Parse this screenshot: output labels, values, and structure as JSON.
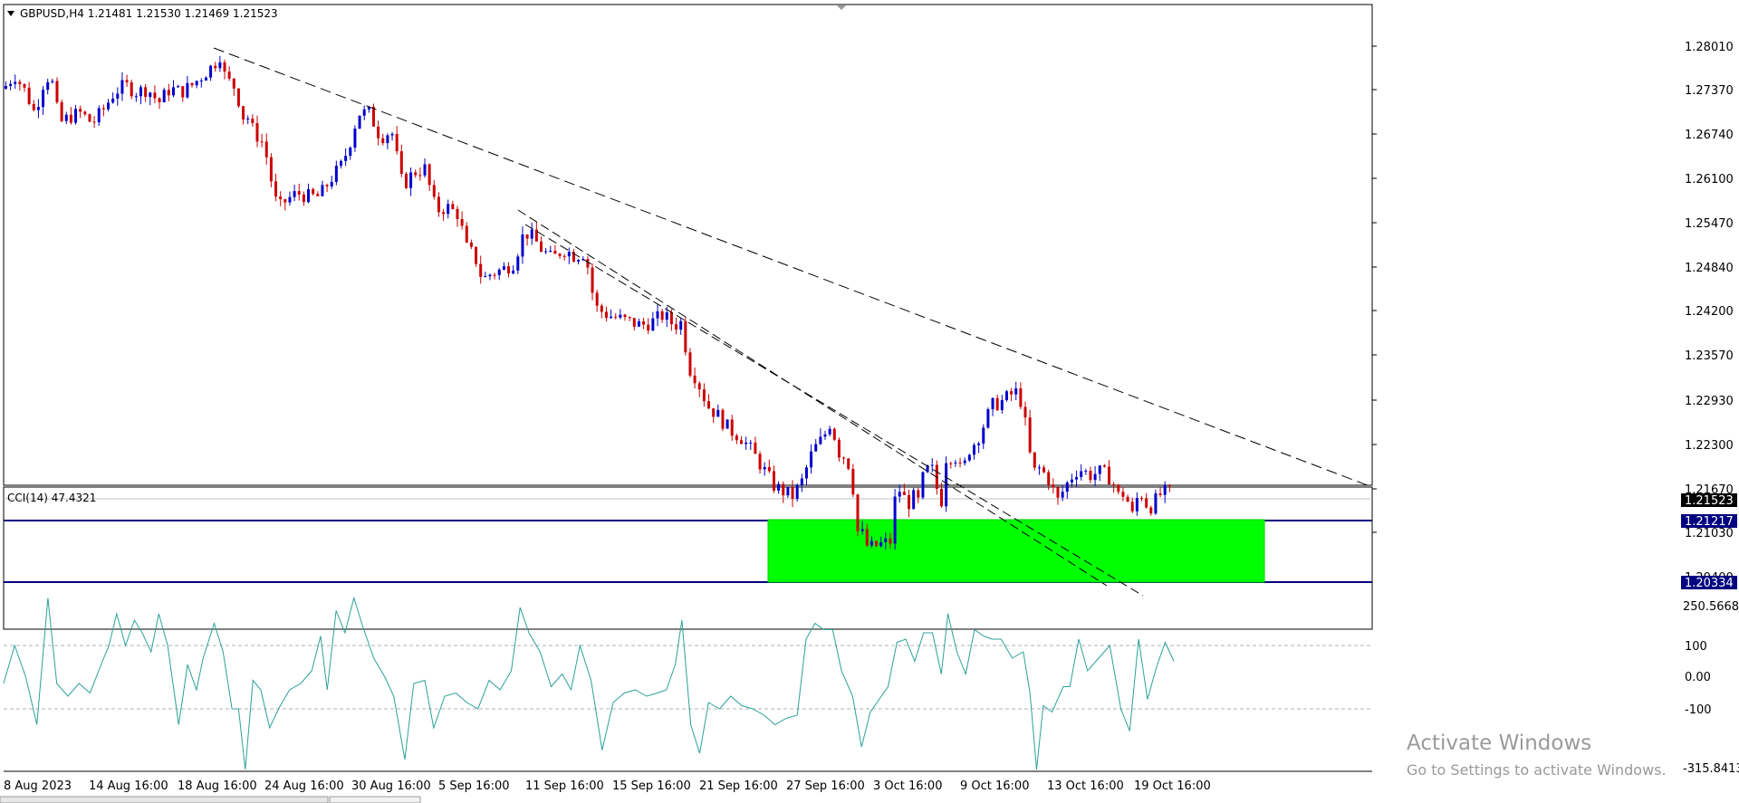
{
  "header": {
    "symbol_line": "GBPUSD,H4  1.21481 1.21530 1.21469 1.21523"
  },
  "price_axis": {
    "ticks": [
      "1.28010",
      "1.27370",
      "1.26740",
      "1.26100",
      "1.25470",
      "1.24840",
      "1.24200",
      "1.23570",
      "1.22930",
      "1.22300",
      "1.21670",
      "1.21030",
      "1.20400"
    ],
    "current_price": "1.21523",
    "support_top": "1.21217",
    "support_bottom": "1.20334"
  },
  "indicator": {
    "label": "CCI(14) 47.4321",
    "ticks": [
      "250.5668",
      "100",
      "0.00",
      "-100",
      "-315.8413"
    ],
    "color": "#2aa198"
  },
  "time_axis": {
    "labels": [
      "8 Aug 2023",
      "14 Aug 16:00",
      "18 Aug 16:00",
      "24 Aug 16:00",
      "30 Aug 16:00",
      "5 Sep 16:00",
      "11 Sep 16:00",
      "15 Sep 16:00",
      "21 Sep 16:00",
      "27 Sep 16:00",
      "3 Oct 16:00",
      "9 Oct 16:00",
      "13 Oct 16:00",
      "19 Oct 16:00"
    ]
  },
  "watermark": {
    "title": "Activate Windows",
    "subtitle": "Go to Settings to activate Windows."
  },
  "colors": {
    "bull": "#0000cc",
    "bear": "#cc0000",
    "support_zone": "#00ff00",
    "level_line": "#000080"
  },
  "chart_data": [
    {
      "type": "candlestick",
      "title": "GBPUSD,H4",
      "x_labels": [
        "8 Aug 2023",
        "14 Aug 16:00",
        "18 Aug 16:00",
        "24 Aug 16:00",
        "30 Aug 16:00",
        "5 Sep 16:00",
        "11 Sep 16:00",
        "15 Sep 16:00",
        "21 Sep 16:00",
        "27 Sep 16:00",
        "3 Oct 16:00",
        "9 Oct 16:00",
        "13 Oct 16:00",
        "19 Oct 16:00"
      ],
      "ylim": [
        1.2033,
        1.284
      ],
      "close_path": [
        [
          0,
          1.274
        ],
        [
          10,
          1.276
        ],
        [
          20,
          1.2735
        ],
        [
          28,
          1.2705
        ],
        [
          38,
          1.276
        ],
        [
          45,
          1.2745
        ],
        [
          50,
          1.269
        ],
        [
          60,
          1.27
        ],
        [
          70,
          1.2705
        ],
        [
          80,
          1.269
        ],
        [
          90,
          1.271
        ],
        [
          100,
          1.2735
        ],
        [
          110,
          1.2745
        ],
        [
          120,
          1.2735
        ],
        [
          130,
          1.274
        ],
        [
          140,
          1.272
        ],
        [
          150,
          1.274
        ],
        [
          160,
          1.2735
        ],
        [
          170,
          1.2745
        ],
        [
          180,
          1.276
        ],
        [
          190,
          1.2775
        ],
        [
          195,
          1.279
        ],
        [
          200,
          1.2755
        ],
        [
          210,
          1.274
        ],
        [
          215,
          1.27
        ],
        [
          220,
          1.27
        ],
        [
          225,
          1.268
        ],
        [
          235,
          1.266
        ],
        [
          240,
          1.262
        ],
        [
          245,
          1.258
        ],
        [
          250,
          1.257
        ],
        [
          255,
          1.258
        ],
        [
          265,
          1.259
        ],
        [
          275,
          1.2585
        ],
        [
          285,
          1.2585
        ],
        [
          295,
          1.261
        ],
        [
          305,
          1.263
        ],
        [
          312,
          1.266
        ],
        [
          320,
          1.2705
        ],
        [
          330,
          1.2705
        ],
        [
          340,
          1.267
        ],
        [
          350,
          1.268
        ],
        [
          355,
          1.264
        ],
        [
          360,
          1.26
        ],
        [
          370,
          1.262
        ],
        [
          380,
          1.2625
        ],
        [
          390,
          1.2565
        ],
        [
          400,
          1.257
        ],
        [
          410,
          1.256
        ],
        [
          418,
          1.251
        ],
        [
          425,
          1.25
        ],
        [
          432,
          1.2465
        ],
        [
          440,
          1.2475
        ],
        [
          450,
          1.248
        ],
        [
          460,
          1.249
        ],
        [
          470,
          1.2535
        ],
        [
          478,
          1.2525
        ],
        [
          485,
          1.251
        ],
        [
          495,
          1.2495
        ],
        [
          505,
          1.251
        ],
        [
          515,
          1.25
        ],
        [
          525,
          1.2505
        ],
        [
          530,
          1.2455
        ],
        [
          535,
          1.2425
        ],
        [
          545,
          1.2415
        ],
        [
          555,
          1.241
        ],
        [
          565,
          1.2405
        ],
        [
          575,
          1.24
        ],
        [
          585,
          1.2405
        ],
        [
          595,
          1.2415
        ],
        [
          605,
          1.24
        ],
        [
          612,
          1.2405
        ],
        [
          618,
          1.234
        ],
        [
          625,
          1.2325
        ],
        [
          635,
          1.2285
        ],
        [
          645,
          1.227
        ],
        [
          655,
          1.225
        ],
        [
          665,
          1.224
        ],
        [
          675,
          1.222
        ],
        [
          685,
          1.2195
        ],
        [
          695,
          1.217
        ],
        [
          705,
          1.216
        ],
        [
          712,
          1.2155
        ],
        [
          720,
          1.2175
        ],
        [
          730,
          1.222
        ],
        [
          740,
          1.224
        ],
        [
          747,
          1.2265
        ],
        [
          752,
          1.222
        ],
        [
          760,
          1.221
        ],
        [
          765,
          1.219
        ],
        [
          770,
          1.2105
        ],
        [
          775,
          1.21
        ],
        [
          780,
          1.208
        ],
        [
          790,
          1.2085
        ],
        [
          800,
          1.209
        ],
        [
          805,
          1.216
        ],
        [
          810,
          1.2165
        ],
        [
          815,
          1.214
        ],
        [
          820,
          1.2155
        ],
        [
          825,
          1.2145
        ],
        [
          830,
          1.2185
        ],
        [
          835,
          1.2195
        ],
        [
          840,
          1.219
        ],
        [
          845,
          1.213
        ],
        [
          850,
          1.221
        ],
        [
          858,
          1.2215
        ],
        [
          865,
          1.2185
        ],
        [
          870,
          1.222
        ],
        [
          878,
          1.2235
        ],
        [
          885,
          1.226
        ],
        [
          892,
          1.2285
        ],
        [
          900,
          1.229
        ],
        [
          908,
          1.23
        ],
        [
          915,
          1.2305
        ],
        [
          920,
          1.228
        ],
        [
          925,
          1.222
        ],
        [
          930,
          1.219
        ],
        [
          935,
          1.2195
        ],
        [
          945,
          1.2175
        ],
        [
          950,
          1.2145
        ],
        [
          955,
          1.216
        ],
        [
          962,
          1.218
        ],
        [
          970,
          1.2195
        ],
        [
          980,
          1.2185
        ],
        [
          990,
          1.219
        ],
        [
          1000,
          1.218
        ],
        [
          1005,
          1.2155
        ],
        [
          1012,
          1.216
        ],
        [
          1018,
          1.2125
        ],
        [
          1025,
          1.2165
        ],
        [
          1030,
          1.2145
        ],
        [
          1035,
          1.214
        ],
        [
          1045,
          1.216
        ],
        [
          1052,
          1.216
        ],
        [
          1056,
          1.2152
        ]
      ]
    },
    {
      "type": "line",
      "title": "CCI(14) 47.4321",
      "ylim": [
        -315.8413,
        250.5668
      ],
      "series": [
        {
          "values": [
            [
              0,
              -20
            ],
            [
              10,
              100
            ],
            [
              20,
              0
            ],
            [
              30,
              -150
            ],
            [
              40,
              250
            ],
            [
              48,
              -20
            ],
            [
              58,
              -60
            ],
            [
              68,
              -20
            ],
            [
              78,
              -50
            ],
            [
              88,
              40
            ],
            [
              95,
              100
            ],
            [
              102,
              200
            ],
            [
              110,
              100
            ],
            [
              118,
              180
            ],
            [
              125,
              140
            ],
            [
              133,
              80
            ],
            [
              140,
              200
            ],
            [
              148,
              100
            ],
            [
              158,
              -150
            ],
            [
              166,
              40
            ],
            [
              174,
              -40
            ],
            [
              180,
              60
            ],
            [
              190,
              170
            ],
            [
              198,
              80
            ],
            [
              206,
              -100
            ],
            [
              212,
              -100
            ],
            [
              218,
              -320
            ],
            [
              225,
              -10
            ],
            [
              232,
              -40
            ],
            [
              240,
              -160
            ],
            [
              248,
              -100
            ],
            [
              258,
              -40
            ],
            [
              268,
              -20
            ],
            [
              278,
              20
            ],
            [
              286,
              130
            ],
            [
              292,
              -40
            ],
            [
              300,
              210
            ],
            [
              308,
              140
            ],
            [
              316,
              250
            ],
            [
              324,
              160
            ],
            [
              334,
              60
            ],
            [
              344,
              0
            ],
            [
              352,
              -60
            ],
            [
              362,
              -260
            ],
            [
              370,
              -20
            ],
            [
              380,
              -10
            ],
            [
              388,
              -160
            ],
            [
              398,
              -60
            ],
            [
              408,
              -50
            ],
            [
              418,
              -80
            ],
            [
              428,
              -100
            ],
            [
              438,
              -10
            ],
            [
              448,
              -40
            ],
            [
              458,
              20
            ],
            [
              466,
              220
            ],
            [
              474,
              140
            ],
            [
              484,
              80
            ],
            [
              494,
              -30
            ],
            [
              504,
              10
            ],
            [
              512,
              -40
            ],
            [
              520,
              100
            ],
            [
              530,
              -10
            ],
            [
              540,
              -230
            ],
            [
              550,
              -80
            ],
            [
              560,
              -50
            ],
            [
              570,
              -40
            ],
            [
              580,
              -60
            ],
            [
              590,
              -50
            ],
            [
              598,
              -40
            ],
            [
              606,
              40
            ],
            [
              612,
              180
            ],
            [
              620,
              -150
            ],
            [
              628,
              -240
            ],
            [
              636,
              -80
            ],
            [
              646,
              -100
            ],
            [
              656,
              -60
            ],
            [
              666,
              -90
            ],
            [
              676,
              -100
            ],
            [
              686,
              -120
            ],
            [
              696,
              -150
            ],
            [
              706,
              -130
            ],
            [
              716,
              -120
            ],
            [
              724,
              120
            ],
            [
              732,
              170
            ],
            [
              740,
              150
            ],
            [
              748,
              150
            ],
            [
              756,
              20
            ],
            [
              766,
              -60
            ],
            [
              774,
              -220
            ],
            [
              782,
              -110
            ],
            [
              790,
              -70
            ],
            [
              798,
              -30
            ],
            [
              806,
              110
            ],
            [
              814,
              120
            ],
            [
              822,
              50
            ],
            [
              830,
              140
            ],
            [
              838,
              140
            ],
            [
              846,
              10
            ],
            [
              852,
              200
            ],
            [
              860,
              80
            ],
            [
              868,
              10
            ],
            [
              876,
              150
            ],
            [
              884,
              130
            ],
            [
              892,
              120
            ],
            [
              900,
              120
            ],
            [
              910,
              60
            ],
            [
              920,
              80
            ],
            [
              926,
              -50
            ],
            [
              932,
              -300
            ],
            [
              938,
              -90
            ],
            [
              946,
              -110
            ],
            [
              956,
              -30
            ],
            [
              962,
              -30
            ],
            [
              970,
              120
            ],
            [
              978,
              20
            ],
            [
              988,
              60
            ],
            [
              998,
              100
            ],
            [
              1008,
              -100
            ],
            [
              1016,
              -170
            ],
            [
              1024,
              120
            ],
            [
              1032,
              -70
            ],
            [
              1040,
              30
            ],
            [
              1048,
              110
            ],
            [
              1056,
              50
            ]
          ]
        }
      ]
    }
  ]
}
